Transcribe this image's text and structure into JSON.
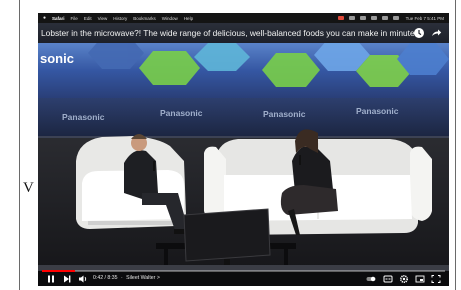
{
  "menubar": {
    "app": "Safari",
    "items": [
      "File",
      "Edit",
      "View",
      "History",
      "Bookmarks",
      "Window",
      "Help"
    ],
    "clock": "Tue Feb 7 5:41 PM"
  },
  "video": {
    "title": "Lobster in the microwave?! The wide range of delicious, well-balanced foods you can make in minutes",
    "time": "0:42 / 8:35",
    "chapter": "Sileet Walter >",
    "progress": 0.082
  },
  "scene": {
    "brand": "sonic",
    "brand_repeats": [
      "Panasonic",
      "Panasonic",
      "Panasonic",
      "Panasonic"
    ]
  },
  "stray_char": "V",
  "colors": {
    "progress": "#ff0000",
    "title_bg": "#23262f",
    "stage_blue": "#3b5fa8",
    "hex_green": "#7fd14a"
  }
}
